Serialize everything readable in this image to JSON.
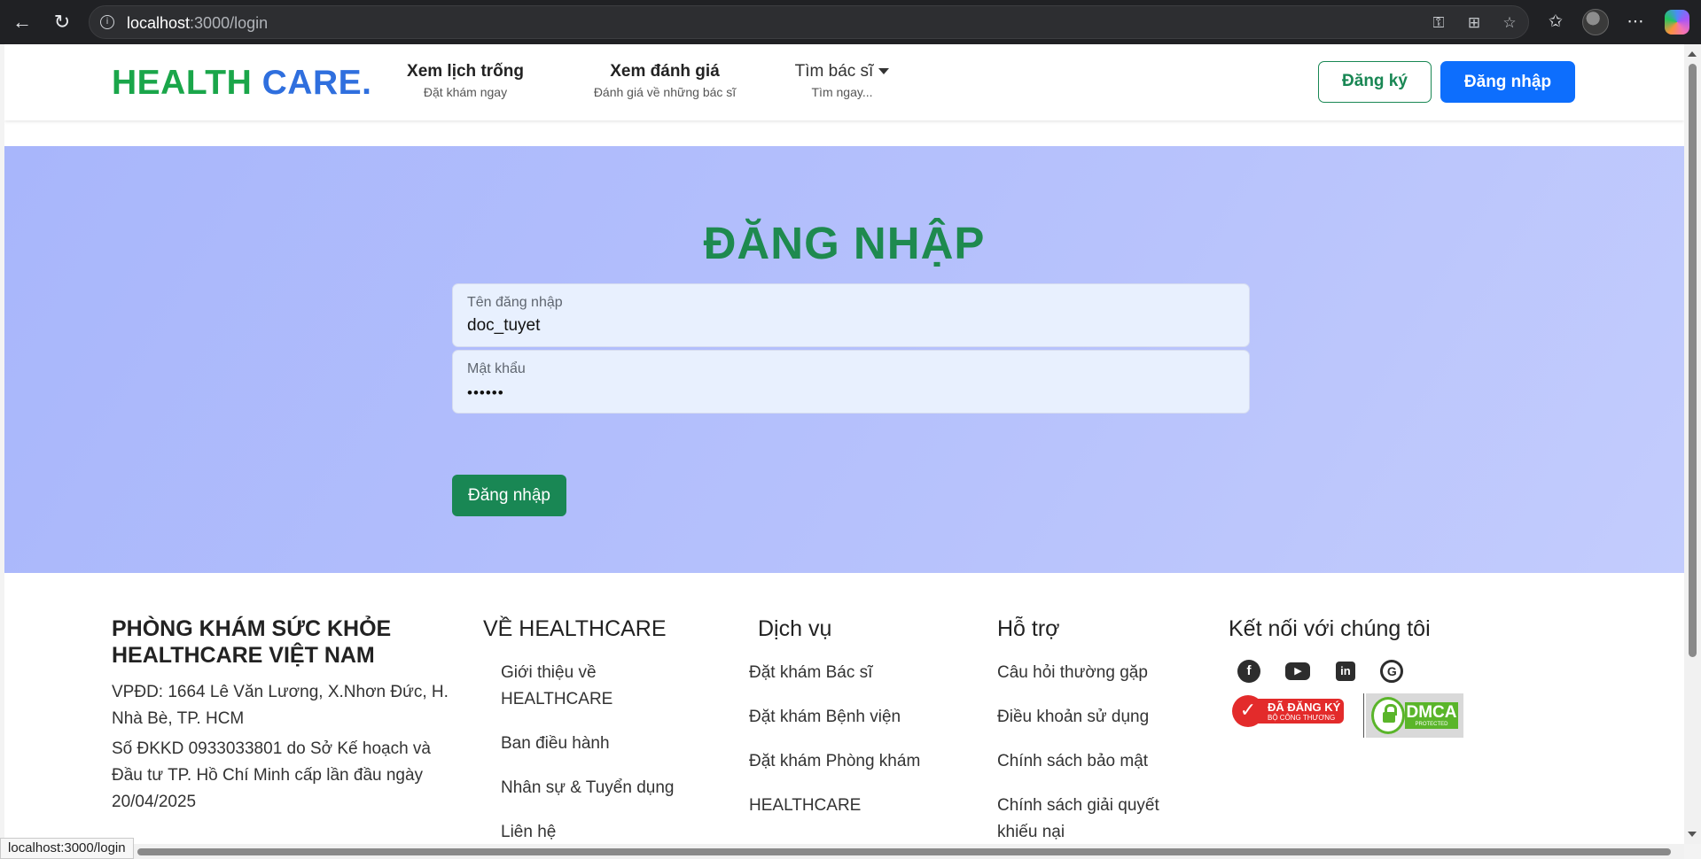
{
  "browser": {
    "url_host": "localhost",
    "url_path": ":3000/login",
    "status_url": "localhost:3000/login"
  },
  "header": {
    "logo_part1": "HEALTH",
    "logo_part2": "CARE.",
    "nav": [
      {
        "title": "Xem lịch trống",
        "subtitle": "Đặt khám ngay"
      },
      {
        "title": "Xem đánh giá",
        "subtitle": "Đánh giá về những bác sĩ"
      },
      {
        "title": "Tìm bác sĩ",
        "subtitle": "Tìm ngay..."
      }
    ],
    "register_label": "Đăng ký",
    "login_label": "Đăng nhập"
  },
  "login": {
    "title": "ĐĂNG NHẬP",
    "username_label": "Tên đăng nhập",
    "username_value": "doc_tuyet",
    "password_label": "Mật khẩu",
    "password_value": "••••••",
    "submit_label": "Đăng nhập"
  },
  "footer": {
    "col1": {
      "heading_line1": "PHÒNG KHÁM SỨC KHỎE",
      "heading_line2": "HEALTHCARE VIỆT NAM",
      "address_line1": "VPĐD: 1664 Lê Văn Lương, X.Nhơn Đức, H.",
      "address_line2": "Nhà Bè, TP. HCM",
      "license_line1": "Số ĐKKD 0933033801 do Sở Kế hoạch và",
      "license_line2": "Đầu tư TP. Hồ Chí Minh cấp lần đầu ngày",
      "license_line3": "20/04/2025"
    },
    "col2": {
      "heading": "VỀ HEALTHCARE",
      "link1_line1": "Giới thiệu về",
      "link1_line2": "HEALTHCARE",
      "link2": "Ban điều hành",
      "link3": "Nhân sự & Tuyển dụng",
      "link4": "Liên hệ"
    },
    "col3": {
      "heading": "Dịch vụ",
      "link1": "Đặt khám Bác sĩ",
      "link2": "Đặt khám Bệnh viện",
      "link3": "Đặt khám Phòng khám",
      "link4": "HEALTHCARE"
    },
    "col4": {
      "heading": "Hỗ trợ",
      "link1": "Câu hỏi thường gặp",
      "link2": "Điều khoản sử dụng",
      "link3": "Chính sách bảo mật",
      "link4_line1": "Chính sách giải quyết",
      "link4_line2": "khiếu nại"
    },
    "col5": {
      "heading": "Kết nối với chúng tôi",
      "social_icons": [
        "facebook-icon",
        "youtube-icon",
        "linkedin-icon",
        "google-icon"
      ],
      "badge_bct_line1": "ĐÃ ĐĂNG KÝ",
      "badge_bct_line2": "BỘ CÔNG THƯƠNG",
      "badge_dmca": "DMCA",
      "badge_dmca_sub": "PROTECTED"
    }
  },
  "colors": {
    "brand_green": "#1aa64a",
    "brand_blue": "#2f6fde",
    "primary": "#0d6efd",
    "success": "#198754",
    "title_green": "#1e8a4f",
    "hero_bg": "#b1bdfc"
  }
}
